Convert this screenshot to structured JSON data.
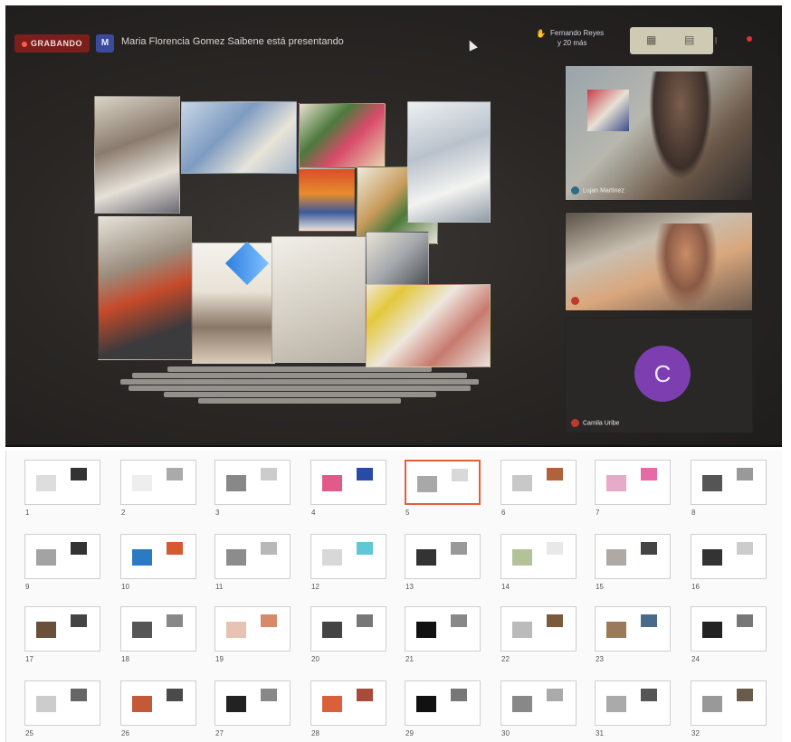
{
  "call": {
    "recording_label": "GRABANDO",
    "presenter_initial": "M",
    "presenting_text": "Maria Florencia Gomez Saibene está presentando",
    "participants_name": "Fernando Reyes",
    "participants_more": "y 20 más",
    "participants": [
      {
        "name": "Lujan Martinez",
        "mic": "blue"
      },
      {
        "name": "",
        "mic": "red"
      },
      {
        "name": "Camila Uribe",
        "mic": "red",
        "initial": "C"
      }
    ]
  },
  "slides": {
    "selected": 5,
    "numbers": [
      "1",
      "2",
      "3",
      "4",
      "5",
      "6",
      "7",
      "8",
      "9",
      "10",
      "11",
      "12",
      "13",
      "14",
      "15",
      "16",
      "17",
      "18",
      "19",
      "20",
      "21",
      "22",
      "23",
      "24",
      "25",
      "26",
      "27",
      "28",
      "29",
      "30",
      "31",
      "32"
    ]
  },
  "colors": {
    "recording_badge": "#7b1e1c",
    "avatar_purple": "#7d3fb0",
    "selected_border": "#e0603c",
    "presenter_avatar": "#3c4a9e"
  },
  "icons": {
    "cursor": "cursor-icon",
    "hand": "raise-hand-icon",
    "layout": "layout-icon",
    "grid": "grid-icon"
  }
}
